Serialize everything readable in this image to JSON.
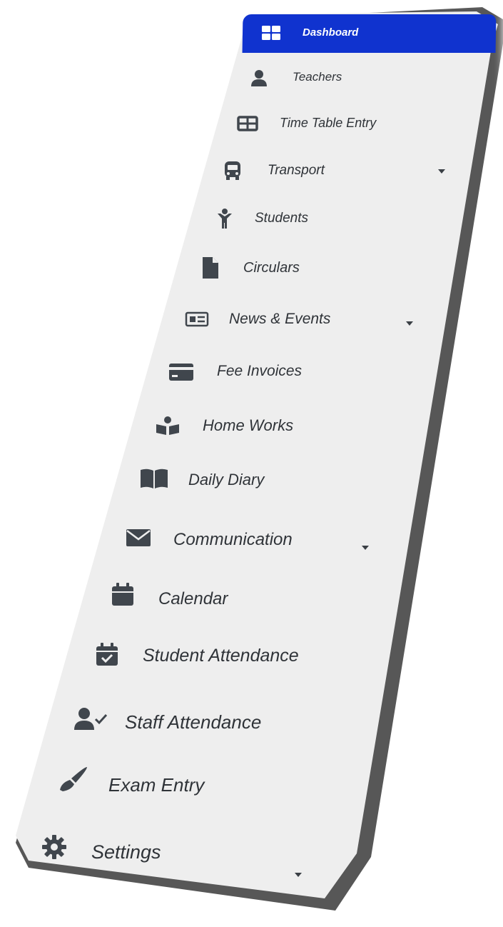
{
  "sidebar": {
    "items": [
      {
        "label": "Dashboard",
        "icon": "dashboard-grid-icon",
        "active": true
      },
      {
        "label": "Teachers",
        "icon": "user-icon"
      },
      {
        "label": "Time Table Entry",
        "icon": "table-icon"
      },
      {
        "label": "Transport",
        "icon": "bus-icon",
        "expandable": true
      },
      {
        "label": "Students",
        "icon": "child-icon"
      },
      {
        "label": "Circulars",
        "icon": "file-icon"
      },
      {
        "label": "News & Events",
        "icon": "newspaper-icon",
        "expandable": true
      },
      {
        "label": "Fee Invoices",
        "icon": "credit-card-icon"
      },
      {
        "label": "Home Works",
        "icon": "book-reader-icon"
      },
      {
        "label": "Daily Diary",
        "icon": "open-book-icon"
      },
      {
        "label": "Communication",
        "icon": "envelope-icon",
        "expandable": true
      },
      {
        "label": "Calendar",
        "icon": "calendar-icon"
      },
      {
        "label": "Student Attendance",
        "icon": "calendar-check-icon"
      },
      {
        "label": "Staff Attendance",
        "icon": "user-check-icon"
      },
      {
        "label": "Exam Entry",
        "icon": "pen-icon"
      },
      {
        "label": "Settings",
        "icon": "gear-icon",
        "expandable": true
      }
    ]
  },
  "colors": {
    "active_background": "#1033cf",
    "panel_background": "#eeeeee",
    "text": "#2f3338"
  }
}
